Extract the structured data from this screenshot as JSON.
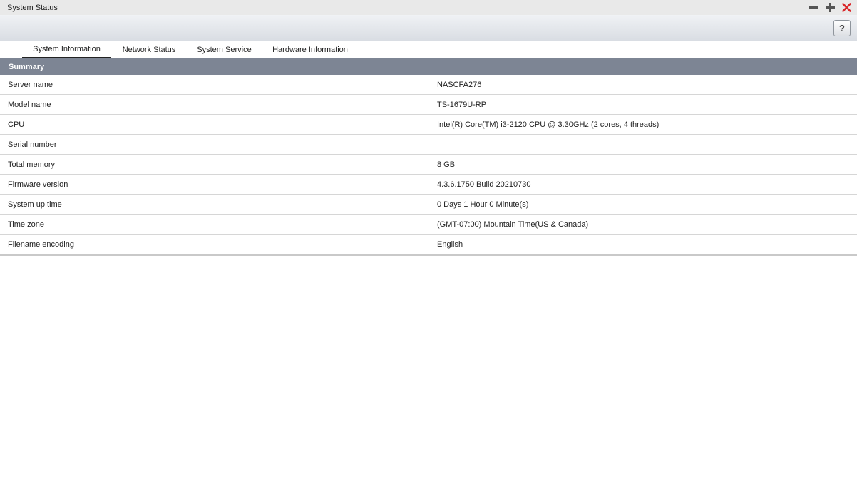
{
  "window": {
    "title": "System Status",
    "controls": [
      "minimize-icon",
      "maximize-icon",
      "close-icon"
    ],
    "close_color": "#d9282b"
  },
  "toolbar": {
    "help_label": "?"
  },
  "tabs": [
    {
      "label": "System Information",
      "active": true
    },
    {
      "label": "Network Status",
      "active": false
    },
    {
      "label": "System Service",
      "active": false
    },
    {
      "label": "Hardware Information",
      "active": false
    }
  ],
  "summary": {
    "header": "Summary",
    "rows": [
      {
        "label": "Server name",
        "value": "NASCFA276"
      },
      {
        "label": "Model name",
        "value": "TS-1679U-RP"
      },
      {
        "label": "CPU",
        "value": "Intel(R) Core(TM) i3-2120 CPU @ 3.30GHz (2 cores, 4 threads)"
      },
      {
        "label": "Serial number",
        "value": ""
      },
      {
        "label": "Total memory",
        "value": "8 GB"
      },
      {
        "label": "Firmware version",
        "value": "4.3.6.1750 Build 20210730"
      },
      {
        "label": "System up time",
        "value": "0 Days 1 Hour 0 Minute(s)"
      },
      {
        "label": "Time zone",
        "value": "(GMT-07:00) Mountain Time(US & Canada)"
      },
      {
        "label": "Filename encoding",
        "value": "English"
      }
    ]
  }
}
